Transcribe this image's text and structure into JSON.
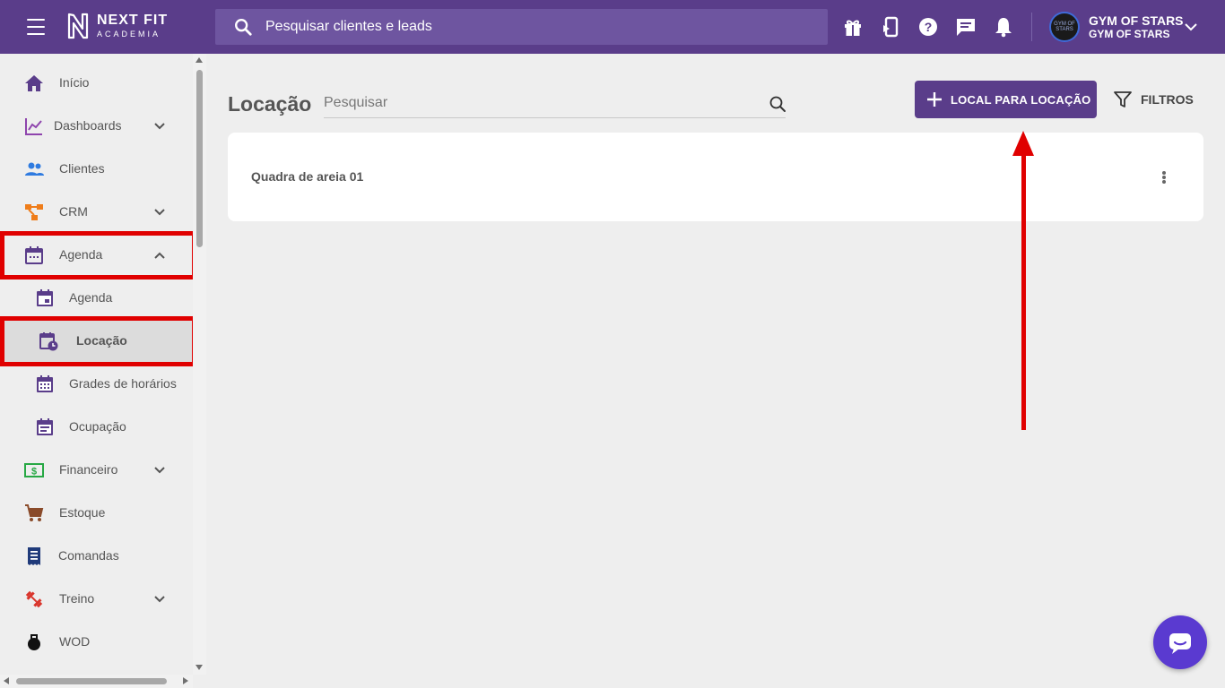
{
  "app": {
    "logo_line1": "NEXT FIT",
    "logo_line2": "ACADEMIA",
    "search_placeholder": "Pesquisar clientes e leads"
  },
  "account": {
    "name": "GYM OF STARS",
    "subname": "GYM OF STARS",
    "avatar_text": "GYM OF STARS"
  },
  "sidebar": {
    "items": [
      {
        "label": "Início",
        "icon": "home-icon"
      },
      {
        "label": "Dashboards",
        "icon": "chart-line-icon",
        "expandable": true
      },
      {
        "label": "Clientes",
        "icon": "people-icon"
      },
      {
        "label": "CRM",
        "icon": "crm-flow-icon",
        "expandable": true
      },
      {
        "label": "Agenda",
        "icon": "calendar-icon",
        "expanded": true
      },
      {
        "label": "Agenda",
        "icon": "calendar-day-icon",
        "sub": true
      },
      {
        "label": "Locação",
        "icon": "calendar-clock-icon",
        "sub": true,
        "active": true
      },
      {
        "label": "Grades de horários",
        "icon": "calendar-grid-icon",
        "sub": true
      },
      {
        "label": "Ocupação",
        "icon": "calendar-list-icon",
        "sub": true
      },
      {
        "label": "Financeiro",
        "icon": "money-icon",
        "expandable": true
      },
      {
        "label": "Estoque",
        "icon": "cart-icon"
      },
      {
        "label": "Comandas",
        "icon": "receipt-icon"
      },
      {
        "label": "Treino",
        "icon": "dumbbell-icon",
        "expandable": true
      },
      {
        "label": "WOD",
        "icon": "kettlebell-icon"
      }
    ]
  },
  "page": {
    "title": "Locação",
    "search_placeholder": "Pesquisar",
    "add_button": "LOCAL PARA LOCAÇÃO",
    "filter_button": "FILTROS"
  },
  "locations": [
    {
      "name": "Quadra de areia 01"
    }
  ],
  "colors": {
    "brand": "#5a3d8a",
    "highlight": "#e00000",
    "chat": "#5a3ad0"
  }
}
